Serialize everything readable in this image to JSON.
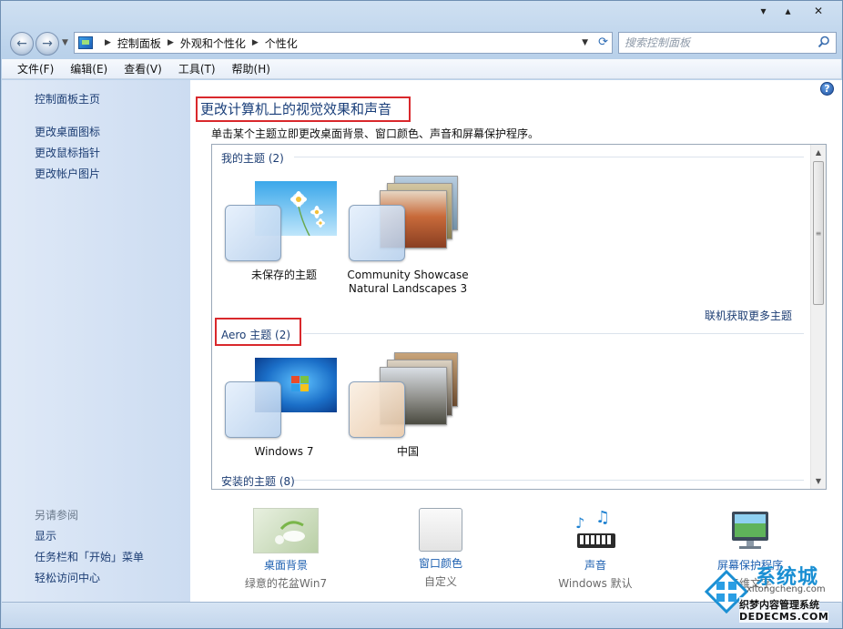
{
  "address": {
    "crumbs": [
      "控制面板",
      "外观和个性化",
      "个性化"
    ],
    "search_placeholder": "搜索控制面板"
  },
  "menu": [
    "文件(F)",
    "编辑(E)",
    "查看(V)",
    "工具(T)",
    "帮助(H)"
  ],
  "sidebar": {
    "links": [
      "控制面板主页",
      "更改桌面图标",
      "更改鼠标指针",
      "更改帐户图片"
    ],
    "see_also_heading": "另请参阅",
    "see_also": [
      "显示",
      "任务栏和「开始」菜单",
      "轻松访问中心"
    ]
  },
  "main": {
    "title": "更改计算机上的视觉效果和声音",
    "subtitle": "单击某个主题立即更改桌面背景、窗口颜色、声音和屏幕保护程序。",
    "groups": {
      "my": {
        "heading": "我的主题 (2)"
      },
      "aero": {
        "heading": "Aero 主题 (2)"
      },
      "installed": {
        "heading": "安装的主题 (8)"
      }
    },
    "themes": {
      "unsaved": "未保存的主题",
      "community": "Community Showcase Natural Landscapes 3",
      "win7": "Windows 7",
      "china": "中国"
    },
    "more_themes_link": "联机获取更多主题"
  },
  "bottom": [
    {
      "label": "桌面背景",
      "value": "绿意的花盆Win7"
    },
    {
      "label": "窗口颜色",
      "value": "自定义"
    },
    {
      "label": "声音",
      "value": "Windows 默认"
    },
    {
      "label": "屏幕保护程序",
      "value": "三维文字"
    }
  ],
  "watermark": {
    "brand": "系统城",
    "site": "xitongcheng.com",
    "line1": "织梦内容管理系统",
    "line2": "DEDECMS.COM"
  },
  "colors": {
    "highlight_box": "#d9282c",
    "link": "#1c3d73",
    "accent": "#1c5fb0"
  }
}
